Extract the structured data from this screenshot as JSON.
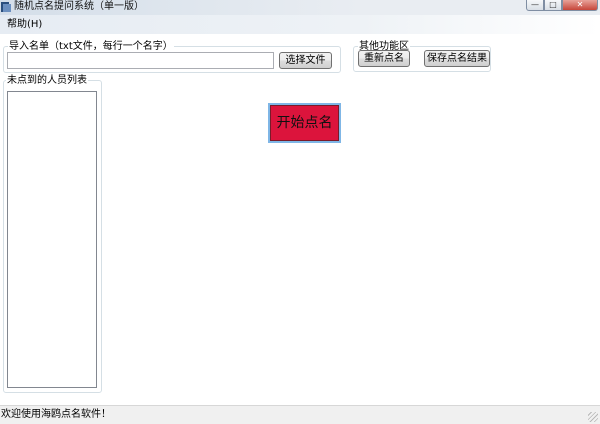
{
  "window": {
    "title": "随机点名提问系统（单一版）",
    "controls": {
      "minimize": "—",
      "maximize": "□",
      "close": "✕"
    }
  },
  "menu": {
    "help_label": "帮助(H)"
  },
  "import_group": {
    "legend": "导入名单（txt文件，每行一个名字）",
    "path_value": "",
    "choose_file_label": "选择文件"
  },
  "other_group": {
    "legend": "其他功能区",
    "reroll_label": "重新点名",
    "save_label": "保存点名结果"
  },
  "unpicked_group": {
    "legend": "未点到的人员列表",
    "items": []
  },
  "start_button": {
    "label": "开始点名",
    "color": "#dc143c"
  },
  "status": {
    "text": "欢迎使用海鸥点名软件！"
  },
  "icons": {
    "app": "app-icon",
    "grip": "resize-grip-icon"
  }
}
